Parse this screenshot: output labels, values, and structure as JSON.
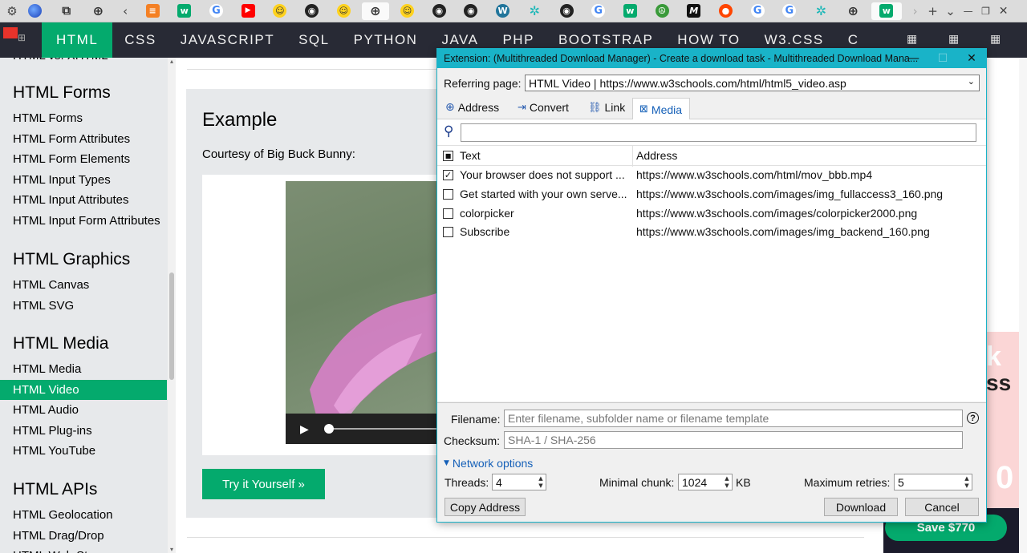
{
  "browser": {
    "active_tab_icon": "w3schools-favicon",
    "tab_icons": [
      "settings-gear",
      "browser-globe",
      "extensions-puzzle",
      "web-globe",
      "back-arrow",
      "stack-overflow",
      "w3schools",
      "google",
      "youtube",
      "hugging-face",
      "github",
      "web-globe",
      "hugging-face",
      "github",
      "github",
      "wordpress",
      "puzzle-green",
      "github",
      "google",
      "w3schools",
      "peace",
      "medium",
      "reddit",
      "google",
      "google",
      "puzzle-green",
      "web-globe",
      "w3schools"
    ],
    "new_tab_label": "+",
    "tab_list_label": "⌄"
  },
  "topnav": {
    "items": [
      "HTML",
      "CSS",
      "JAVASCRIPT",
      "SQL",
      "PYTHON",
      "JAVA",
      "PHP",
      "BOOTSTRAP",
      "HOW TO",
      "W3.CSS",
      "C"
    ],
    "active": "HTML",
    "accent": "#04aa6d"
  },
  "sidebar": {
    "partial_link": "HTML vs. XHTML",
    "sections": [
      {
        "heading": "HTML Forms",
        "links": [
          "HTML Forms",
          "HTML Form Attributes",
          "HTML Form Elements",
          "HTML Input Types",
          "HTML Input Attributes",
          "HTML Input Form Attributes"
        ]
      },
      {
        "heading": "HTML Graphics",
        "links": [
          "HTML Canvas",
          "HTML SVG"
        ]
      },
      {
        "heading": "HTML Media",
        "links": [
          "HTML Media",
          "HTML Video",
          "HTML Audio",
          "HTML Plug-ins",
          "HTML YouTube"
        ]
      },
      {
        "heading": "HTML APIs",
        "links": [
          "HTML Geolocation",
          "HTML Drag/Drop",
          "HTML Web Storage"
        ]
      }
    ],
    "active_link": "HTML Video"
  },
  "main": {
    "example_title": "Example",
    "example_text": "Courtesy of Big Buck Bunny:",
    "try_button": "Try it Yourself »",
    "ad_partial_top": "k",
    "ad_partial_mid": "ss",
    "ad_partial_num": "0",
    "ad_button": "Save $770"
  },
  "dialog": {
    "title": "Extension: (Multithreaded Download Manager) - Create a download task - Multithreaded Download Mana...",
    "referring_label": "Referring page:",
    "referring_value": "HTML Video | https://www.w3schools.com/html/html5_video.asp",
    "tabs": [
      "Address",
      "Convert",
      "Link",
      "Media"
    ],
    "active_tab": "Media",
    "search_value": "",
    "columns": [
      "Text",
      "Address"
    ],
    "rows": [
      {
        "text": "Your browser does not support ...",
        "address": "https://www.w3schools.com/html/mov_bbb.mp4",
        "checked": true
      },
      {
        "text": "Get started with your own serve...",
        "address": "https://www.w3schools.com/images/img_fullaccess3_160.png",
        "checked": false
      },
      {
        "text": "colorpicker",
        "address": "https://www.w3schools.com/images/colorpicker2000.png",
        "checked": false
      },
      {
        "text": "Subscribe",
        "address": "https://www.w3schools.com/images/img_backend_160.png",
        "checked": false
      }
    ],
    "filename_label": "Filename:",
    "filename_placeholder": "Enter filename, subfolder name or filename template",
    "help_label": "?",
    "checksum_label": "Checksum:",
    "checksum_placeholder": "SHA-1 / SHA-256",
    "network_options": "Network options",
    "threads_label": "Threads:",
    "threads_value": "4",
    "chunk_label": "Minimal chunk:",
    "chunk_value": "1024",
    "chunk_unit": "KB",
    "retries_label": "Maximum retries:",
    "retries_value": "5",
    "copy_button": "Copy Address",
    "download_button": "Download",
    "cancel_button": "Cancel",
    "accent": "#19b3c8"
  }
}
